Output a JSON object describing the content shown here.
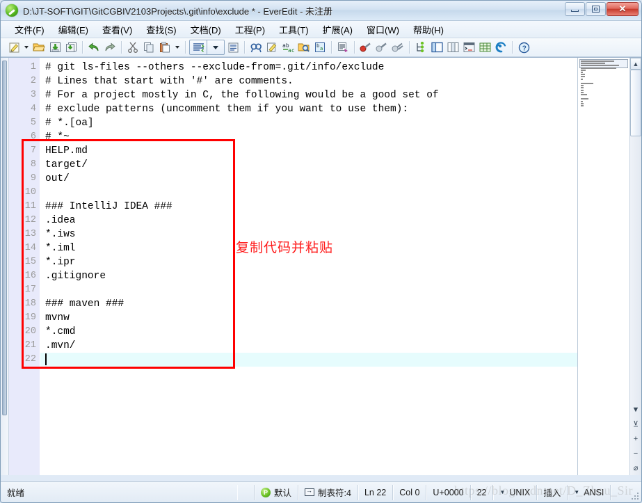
{
  "window": {
    "title": "D:\\JT-SOFT\\GIT\\GitCGBIV2103Projects\\.git\\info\\exclude * - EverEdit - 未注册",
    "app_icon": "pencil-icon",
    "minimize_label": "最小化",
    "restore_label": "还原",
    "close_label": "✕"
  },
  "menubar": {
    "items": [
      {
        "label": "文件(F)",
        "name": "menu-file"
      },
      {
        "label": "编辑(E)",
        "name": "menu-edit"
      },
      {
        "label": "查看(V)",
        "name": "menu-view"
      },
      {
        "label": "查找(S)",
        "name": "menu-search"
      },
      {
        "label": "文档(D)",
        "name": "menu-document"
      },
      {
        "label": "工程(P)",
        "name": "menu-project"
      },
      {
        "label": "工具(T)",
        "name": "menu-tools"
      },
      {
        "label": "扩展(A)",
        "name": "menu-extension"
      },
      {
        "label": "窗口(W)",
        "name": "menu-window"
      },
      {
        "label": "帮助(H)",
        "name": "menu-help"
      }
    ]
  },
  "toolbar": {
    "icons": [
      "new-file-icon",
      "new-file-dropdown-icon",
      "open-folder-icon",
      "save-icon",
      "save-all-icon",
      "undo-icon",
      "redo-icon",
      "cut-icon",
      "copy-icon",
      "paste-icon",
      "paste-dropdown-icon",
      "indent-guide-icon",
      "indent-dropdown-icon",
      "word-wrap-icon",
      "find-icon",
      "replace-icon",
      "find-in-files-icon",
      "goto-icon",
      "bookmark-icon",
      "column-mode-icon",
      "record-macro-icon",
      "play-macro-icon",
      "play-macro-multi-icon",
      "project-tree-icon",
      "explorer-panel-icon",
      "split-view-icon",
      "console-icon",
      "table-icon",
      "browser-preview-icon",
      "help-icon"
    ]
  },
  "editor": {
    "lines": [
      {
        "n": "1",
        "text": "# git ls-files --others --exclude-from=.git/info/exclude"
      },
      {
        "n": "2",
        "text": "# Lines that start with '#' are comments."
      },
      {
        "n": "3",
        "text": "# For a project mostly in C, the following would be a good set of"
      },
      {
        "n": "4",
        "text": "# exclude patterns (uncomment them if you want to use them):"
      },
      {
        "n": "5",
        "text": "# *.[oa]"
      },
      {
        "n": "6",
        "text": "# *~"
      },
      {
        "n": "7",
        "text": "HELP.md"
      },
      {
        "n": "8",
        "text": "target/"
      },
      {
        "n": "9",
        "text": "out/"
      },
      {
        "n": "10",
        "text": ""
      },
      {
        "n": "11",
        "text": "### IntelliJ IDEA ###"
      },
      {
        "n": "12",
        "text": ".idea"
      },
      {
        "n": "13",
        "text": "*.iws"
      },
      {
        "n": "14",
        "text": "*.iml"
      },
      {
        "n": "15",
        "text": "*.ipr"
      },
      {
        "n": "16",
        "text": ".gitignore"
      },
      {
        "n": "17",
        "text": ""
      },
      {
        "n": "18",
        "text": "### maven ###"
      },
      {
        "n": "19",
        "text": "mvnw"
      },
      {
        "n": "20",
        "text": "*.cmd"
      },
      {
        "n": "21",
        "text": ".mvn/"
      },
      {
        "n": "22",
        "text": ""
      }
    ],
    "current_line_index": 21,
    "current_line_color": "#e6fcfd",
    "gutter_color": "#e8eafb"
  },
  "annotation": {
    "text": "复制代码并粘贴",
    "color": "#ff0000",
    "rect_label": "pasted-code-highlight"
  },
  "statusbar": {
    "ready": "就绪",
    "syntax": "默认",
    "syntax_badge": "P",
    "tab_width": "制表符:4",
    "line": "Ln 22",
    "col": "Col 0",
    "unicode": "U+0000",
    "total_lines": "22",
    "line_ending": "UNIX",
    "insert_mode": "插入",
    "encoding": "ANSI"
  },
  "watermark": {
    "text": "https://blog.csdn.net/D_Zhou_Sir"
  },
  "scrollbar": {
    "up_arrow": "▲",
    "down_arrow": "▼",
    "zoom_in": "+",
    "zoom_out": "−",
    "bookmark_next": "⊻",
    "marker": "⌀"
  }
}
